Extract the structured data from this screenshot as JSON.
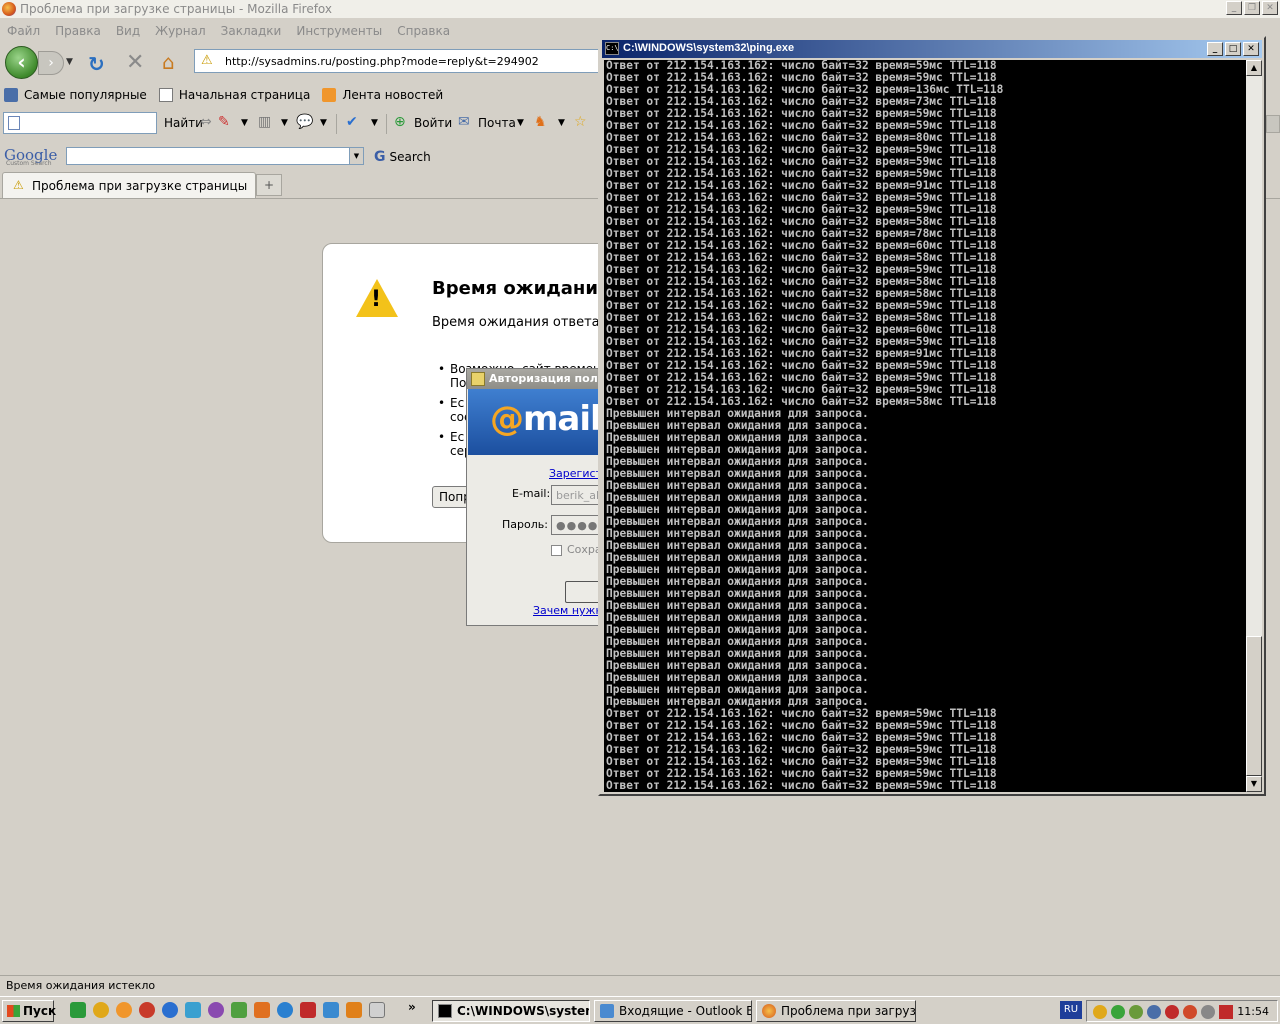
{
  "firefox": {
    "title": "Проблема при загрузке страницы - Mozilla Firefox",
    "menu": [
      "Файл",
      "Правка",
      "Вид",
      "Журнал",
      "Закладки",
      "Инструменты",
      "Справка"
    ],
    "url": "http://sysadmins.ru/posting.php?mode=reply&t=294902",
    "bookmarks": [
      "Самые популярные",
      "Начальная страница",
      "Лента новостей"
    ],
    "mailbar": {
      "find_label": "Найти",
      "login_label": "Войти",
      "mail_label": "Почта"
    },
    "google": {
      "logo": "Google",
      "logo_sub": "Custom Search",
      "search_label": "Search"
    },
    "tab_title": "Проблема при загрузке страницы",
    "error": {
      "title": "Время ожидания",
      "subtitle": "Время ожидания ответа с",
      "items": [
        {
          "line1": "Возможно, сайт времен",
          "line2": "По"
        },
        {
          "line1": "Ес",
          "line2": "сое"
        },
        {
          "line1": "Ес",
          "line2": "сер"
        }
      ],
      "try_again": "Попро"
    },
    "status": "Время ожидания истекло"
  },
  "auth_dialog": {
    "title": "Авторизация поль",
    "logo_at": "@",
    "logo_text": "mail",
    "register_link": "Зарегистр",
    "email_label": "E-mail:",
    "email_value": "berik_akt",
    "password_label": "Пароль:",
    "password_value": "●●●●●●●",
    "remember_label": "Сохра",
    "why_link": "Зачем нужна"
  },
  "cmd": {
    "title": "C:\\WINDOWS\\system32\\ping.exe",
    "icon_text": "C:\\",
    "lines": [
      "Ответ от 212.154.163.162: число байт=32 время=59мс TTL=118",
      "Ответ от 212.154.163.162: число байт=32 время=59мс TTL=118",
      "Ответ от 212.154.163.162: число байт=32 время=136мс TTL=118",
      "Ответ от 212.154.163.162: число байт=32 время=73мс TTL=118",
      "Ответ от 212.154.163.162: число байт=32 время=59мс TTL=118",
      "Ответ от 212.154.163.162: число байт=32 время=59мс TTL=118",
      "Ответ от 212.154.163.162: число байт=32 время=80мс TTL=118",
      "Ответ от 212.154.163.162: число байт=32 время=59мс TTL=118",
      "Ответ от 212.154.163.162: число байт=32 время=59мс TTL=118",
      "Ответ от 212.154.163.162: число байт=32 время=59мс TTL=118",
      "Ответ от 212.154.163.162: число байт=32 время=91мс TTL=118",
      "Ответ от 212.154.163.162: число байт=32 время=59мс TTL=118",
      "Ответ от 212.154.163.162: число байт=32 время=59мс TTL=118",
      "Ответ от 212.154.163.162: число байт=32 время=58мс TTL=118",
      "Ответ от 212.154.163.162: число байт=32 время=78мс TTL=118",
      "Ответ от 212.154.163.162: число байт=32 время=60мс TTL=118",
      "Ответ от 212.154.163.162: число байт=32 время=58мс TTL=118",
      "Ответ от 212.154.163.162: число байт=32 время=59мс TTL=118",
      "Ответ от 212.154.163.162: число байт=32 время=58мс TTL=118",
      "Ответ от 212.154.163.162: число байт=32 время=58мс TTL=118",
      "Ответ от 212.154.163.162: число байт=32 время=59мс TTL=118",
      "Ответ от 212.154.163.162: число байт=32 время=58мс TTL=118",
      "Ответ от 212.154.163.162: число байт=32 время=60мс TTL=118",
      "Ответ от 212.154.163.162: число байт=32 время=59мс TTL=118",
      "Ответ от 212.154.163.162: число байт=32 время=91мс TTL=118",
      "Ответ от 212.154.163.162: число байт=32 время=59мс TTL=118",
      "Ответ от 212.154.163.162: число байт=32 время=59мс TTL=118",
      "Ответ от 212.154.163.162: число байт=32 время=59мс TTL=118",
      "Ответ от 212.154.163.162: число байт=32 время=58мс TTL=118",
      "Превышен интервал ожидания для запроса.",
      "Превышен интервал ожидания для запроса.",
      "Превышен интервал ожидания для запроса.",
      "Превышен интервал ожидания для запроса.",
      "Превышен интервал ожидания для запроса.",
      "Превышен интервал ожидания для запроса.",
      "Превышен интервал ожидания для запроса.",
      "Превышен интервал ожидания для запроса.",
      "Превышен интервал ожидания для запроса.",
      "Превышен интервал ожидания для запроса.",
      "Превышен интервал ожидания для запроса.",
      "Превышен интервал ожидания для запроса.",
      "Превышен интервал ожидания для запроса.",
      "Превышен интервал ожидания для запроса.",
      "Превышен интервал ожидания для запроса.",
      "Превышен интервал ожидания для запроса.",
      "Превышен интервал ожидания для запроса.",
      "Превышен интервал ожидания для запроса.",
      "Превышен интервал ожидания для запроса.",
      "Превышен интервал ожидания для запроса.",
      "Превышен интервал ожидания для запроса.",
      "Превышен интервал ожидания для запроса.",
      "Превышен интервал ожидания для запроса.",
      "Превышен интервал ожидания для запроса.",
      "Превышен интервал ожидания для запроса.",
      "Ответ от 212.154.163.162: число байт=32 время=59мс TTL=118",
      "Ответ от 212.154.163.162: число байт=32 время=59мс TTL=118",
      "Ответ от 212.154.163.162: число байт=32 время=59мс TTL=118",
      "Ответ от 212.154.163.162: число байт=32 время=59мс TTL=118",
      "Ответ от 212.154.163.162: число байт=32 время=59мс TTL=118",
      "Ответ от 212.154.163.162: число байт=32 время=59мс TTL=118",
      "Ответ от 212.154.163.162: число байт=32 время=59мс TTL=118"
    ]
  },
  "taskbar": {
    "start_label": "Пуск",
    "more": "»",
    "tasks": [
      {
        "label": "C:\\WINDOWS\\system...",
        "active": true
      },
      {
        "label": "Входящие - Outlook Exp...",
        "active": false
      },
      {
        "label": "Проблема при загрузке...",
        "active": false
      }
    ],
    "lang": "RU",
    "clock": "11:54"
  },
  "colors": {
    "cmd_title_start": "#0a246a",
    "cmd_title_end": "#a6caf0",
    "console_bg": "#000000",
    "console_fg": "#c0c0c0",
    "warning": "#f3c21a",
    "mailru_blue": "#1c4f9f"
  }
}
